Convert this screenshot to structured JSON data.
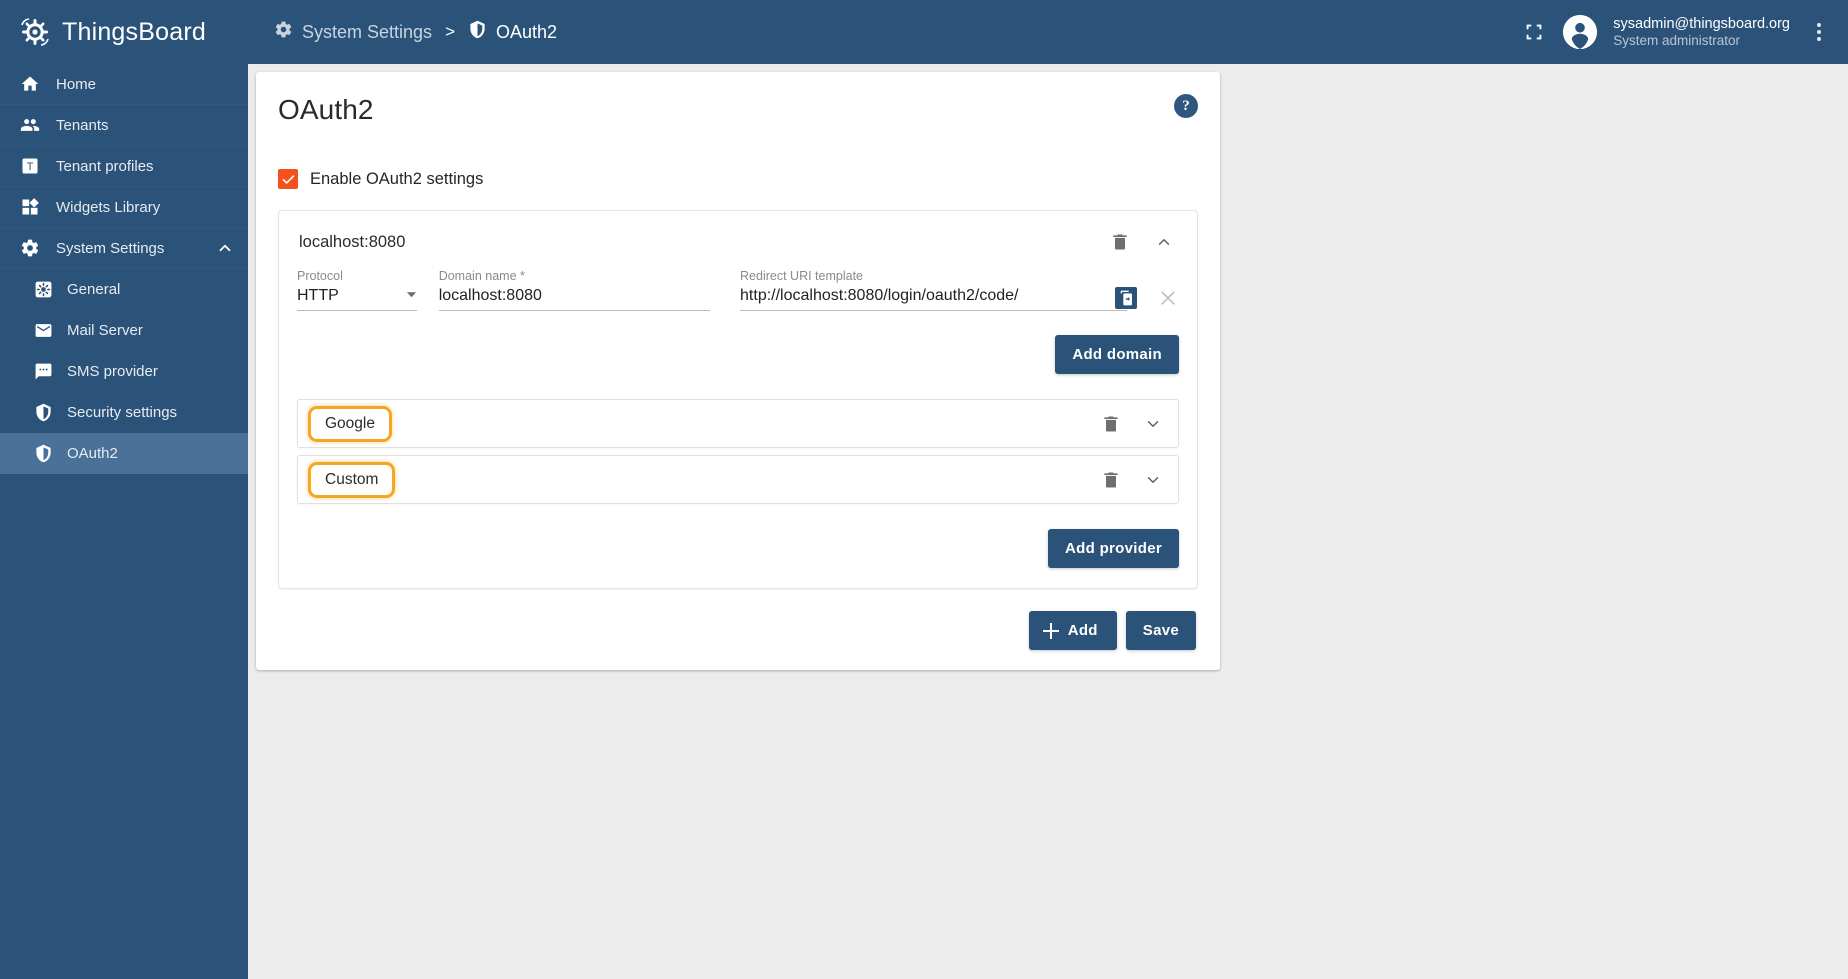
{
  "app": {
    "brand": "ThingsBoard",
    "brand_logo_icon": "thingsboard-logo-icon"
  },
  "sidebar": {
    "items": [
      {
        "label": "Home",
        "icon": "home-icon"
      },
      {
        "label": "Tenants",
        "icon": "people-icon"
      },
      {
        "label": "Tenant profiles",
        "icon": "tenant-profile-icon"
      },
      {
        "label": "Widgets Library",
        "icon": "widgets-icon"
      },
      {
        "label": "System Settings",
        "icon": "gear-icon",
        "expanded": true,
        "expander_icon": "chevron-up-icon"
      }
    ],
    "subitems": [
      {
        "label": "General",
        "icon": "general-gear-icon",
        "active": false
      },
      {
        "label": "Mail Server",
        "icon": "mail-icon",
        "active": false
      },
      {
        "label": "SMS provider",
        "icon": "sms-icon",
        "active": false
      },
      {
        "label": "Security settings",
        "icon": "shield-icon",
        "active": false
      },
      {
        "label": "OAuth2",
        "icon": "shield-icon",
        "active": true
      }
    ]
  },
  "topbar": {
    "breadcrumb": [
      {
        "label": "System Settings",
        "icon": "gear-icon"
      },
      {
        "label": "OAuth2",
        "icon": "shield-icon"
      }
    ],
    "separator": ">",
    "fullscreen_icon": "fullscreen-icon",
    "avatar_icon": "account-circle-icon",
    "user_email": "sysadmin@thingsboard.org",
    "user_role": "System administrator",
    "menu_icon": "kebab-menu-icon"
  },
  "page": {
    "title": "OAuth2",
    "help_label": "?",
    "help_icon": "help-circle-icon",
    "enable_checkbox": {
      "label": "Enable OAuth2 settings",
      "checked": true,
      "color": "#f4511e",
      "check_icon": "checkmark-icon"
    },
    "domain": {
      "title": "localhost:8080",
      "delete_icon": "trash-icon",
      "collapse_icon": "chevron-up-icon",
      "protocol": {
        "label": "Protocol",
        "value": "HTTP",
        "dropdown_icon": "triangle-down-icon"
      },
      "domain_name": {
        "label": "Domain name *",
        "value": "localhost:8080"
      },
      "redirect_uri": {
        "label": "Redirect URI template",
        "value": "http://localhost:8080/login/oauth2/code/",
        "copy_icon": "copy-clipboard-icon",
        "remove_icon": "close-x-icon"
      },
      "add_domain_label": "Add domain"
    },
    "providers": [
      {
        "name": "Google",
        "highlighted": true,
        "delete_icon": "trash-icon",
        "expand_icon": "chevron-down-icon"
      },
      {
        "name": "Custom",
        "highlighted": true,
        "delete_icon": "trash-icon",
        "expand_icon": "chevron-down-icon"
      }
    ],
    "add_provider_label": "Add provider",
    "footer": {
      "add_label": "Add",
      "add_icon": "plus-icon",
      "save_label": "Save"
    }
  },
  "colors": {
    "brand_blue": "#2b5278",
    "accent_orange": "#f4511e",
    "highlight_orange": "#f5a623",
    "page_bg": "#ececec"
  }
}
